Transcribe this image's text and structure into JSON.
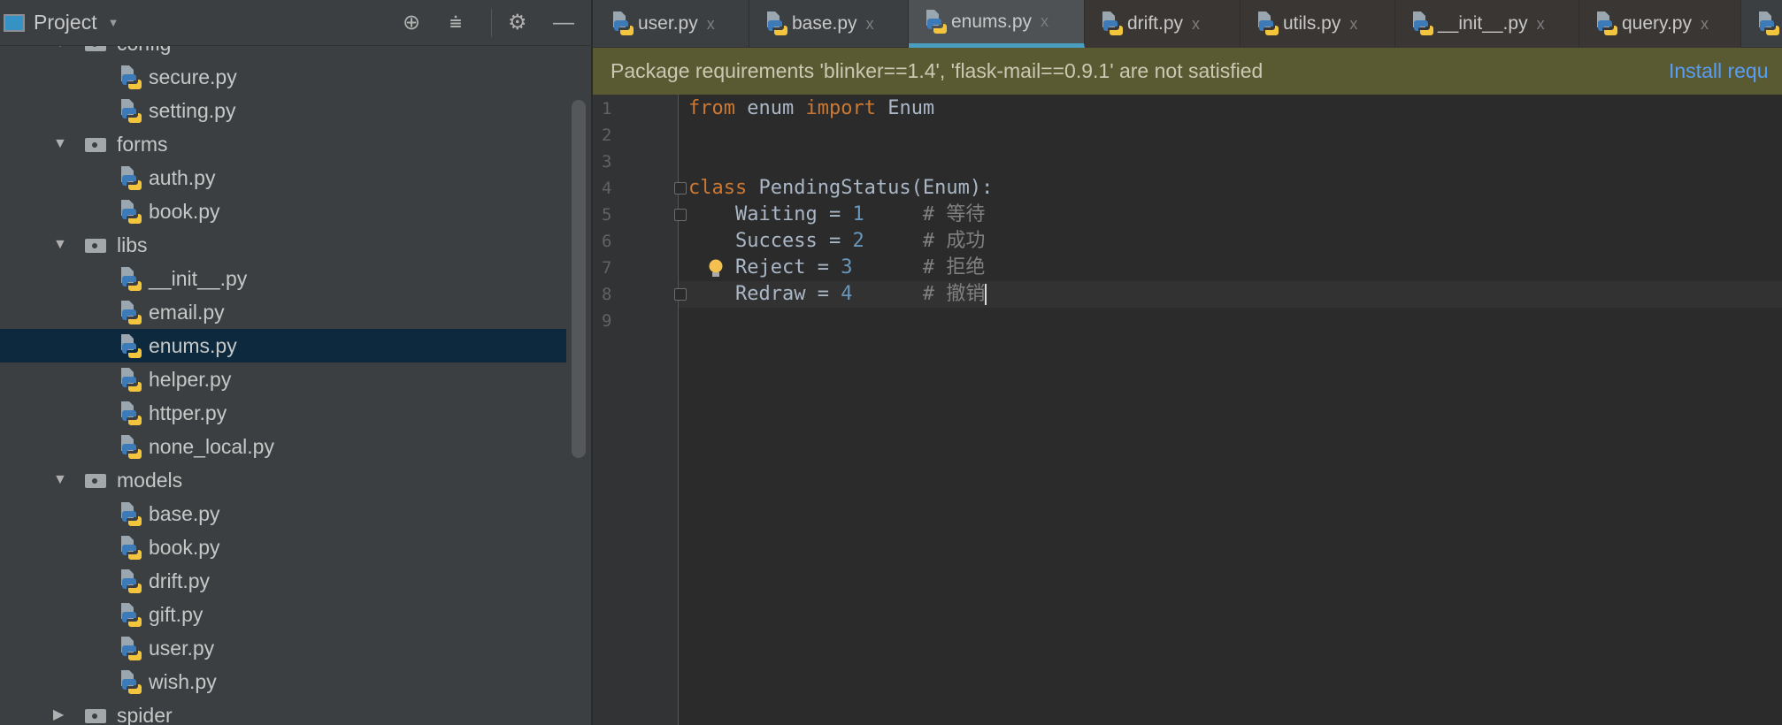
{
  "project_panel": {
    "title": "Project",
    "toolbar_icons": [
      "locate-icon",
      "collapse-all-icon",
      "gear-icon",
      "hide-icon"
    ],
    "tree": [
      {
        "type": "folder",
        "label": "config",
        "expanded": true
      },
      {
        "type": "file",
        "label": "secure.py"
      },
      {
        "type": "file",
        "label": "setting.py"
      },
      {
        "type": "folder",
        "label": "forms",
        "expanded": true
      },
      {
        "type": "file",
        "label": "auth.py"
      },
      {
        "type": "file",
        "label": "book.py"
      },
      {
        "type": "folder",
        "label": "libs",
        "expanded": true
      },
      {
        "type": "file",
        "label": "__init__.py"
      },
      {
        "type": "file",
        "label": "email.py"
      },
      {
        "type": "file",
        "label": "enums.py",
        "selected": true
      },
      {
        "type": "file",
        "label": "helper.py"
      },
      {
        "type": "file",
        "label": "httper.py"
      },
      {
        "type": "file",
        "label": "none_local.py"
      },
      {
        "type": "folder",
        "label": "models",
        "expanded": true
      },
      {
        "type": "file",
        "label": "base.py"
      },
      {
        "type": "file",
        "label": "book.py"
      },
      {
        "type": "file",
        "label": "drift.py"
      },
      {
        "type": "file",
        "label": "gift.py"
      },
      {
        "type": "file",
        "label": "user.py"
      },
      {
        "type": "file",
        "label": "wish.py"
      },
      {
        "type": "folder",
        "label": "spider",
        "expanded": false
      }
    ]
  },
  "tabs": [
    {
      "label": "user.py",
      "close": "x"
    },
    {
      "label": "base.py",
      "close": "x"
    },
    {
      "label": "enums.py",
      "close": "x",
      "active": true
    },
    {
      "label": "drift.py",
      "close": "x"
    },
    {
      "label": "utils.py",
      "close": "x"
    },
    {
      "label": "__init__.py",
      "close": "x"
    },
    {
      "label": "query.py",
      "close": "x"
    }
  ],
  "banner": {
    "message": "Package requirements 'blinker==1.4', 'flask-mail==0.9.1' are not satisfied",
    "action": "Install requ"
  },
  "editor": {
    "line_numbers": [
      "1",
      "2",
      "3",
      "4",
      "5",
      "6",
      "7",
      "8",
      "9"
    ],
    "code": {
      "l1": {
        "kw1": "from",
        "t1": " enum ",
        "kw2": "import",
        "t2": " Enum"
      },
      "l4": {
        "kw": "class",
        "t": " PendingStatus(Enum):"
      },
      "l5": {
        "t": "    Waiting = ",
        "n": "1",
        "sp": "     ",
        "c": "# 等待"
      },
      "l6": {
        "t": "    Success = ",
        "n": "2",
        "sp": "     ",
        "c": "# 成功"
      },
      "l7": {
        "t": "    Reject = ",
        "n": "3",
        "sp": "      ",
        "c": "# 拒绝"
      },
      "l8": {
        "t": "    Redraw = ",
        "n": "4",
        "sp": "      ",
        "c": "# 撤销"
      }
    }
  },
  "colors": {
    "keyword": "#cc7832",
    "number": "#6897bb",
    "comment": "#808080",
    "selection": "#0d293e",
    "accent": "#4a9fc0",
    "banner": "#5a5a32",
    "link": "#589df6"
  }
}
